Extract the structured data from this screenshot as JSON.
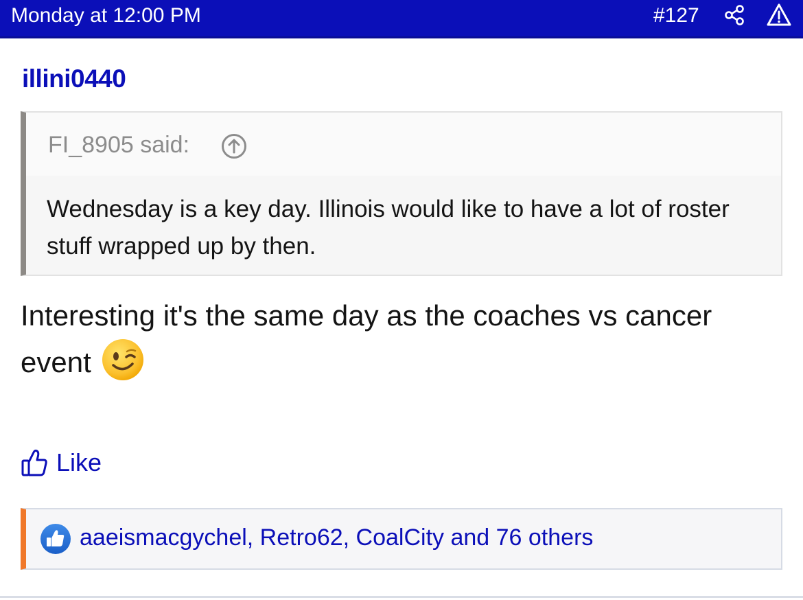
{
  "header": {
    "date": "Monday at 12:00 PM",
    "post_number": "#127",
    "share_icon": "share-icon",
    "report_icon": "warning-icon",
    "bg_color": "#0b0fb8"
  },
  "post": {
    "author": "illini0440",
    "quote": {
      "attribution": "FI_8905 said:",
      "jump_icon": "arrow-up-circle-icon",
      "text": "Wednesday is a key day. Illinois would like to have a lot of roster stuff wrapped up by then."
    },
    "message": "Interesting it's the same day as the coaches vs cancer event",
    "emoji": "winking-face-icon"
  },
  "actions": {
    "like_label": "Like",
    "like_icon": "thumbs-up-icon"
  },
  "reactions": {
    "icon": "like-badge-icon",
    "text": "aaeismacgychel, Retro62, CoalCity and 76 others",
    "accent_color": "#f0782a"
  }
}
